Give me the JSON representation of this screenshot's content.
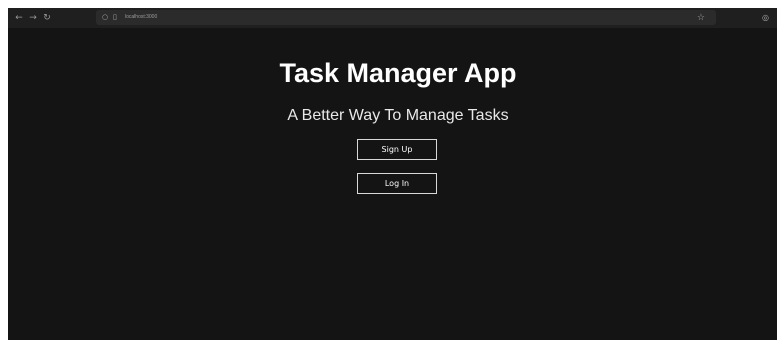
{
  "browser": {
    "url": "localhost:3000",
    "icons": {
      "back": "arrow-left-icon",
      "forward": "arrow-right-icon",
      "reload": "reload-icon",
      "shield": "shield-icon",
      "page": "page-icon",
      "bookmark": "star-icon",
      "extension": "extension-icon"
    }
  },
  "page": {
    "title": "Task Manager App",
    "subtitle": "A Better Way To Manage Tasks",
    "signup_label": "Sign Up",
    "login_label": "Log In"
  },
  "colors": {
    "background": "#141414",
    "text": "#ffffff",
    "button_border": "#d8d8d8"
  }
}
